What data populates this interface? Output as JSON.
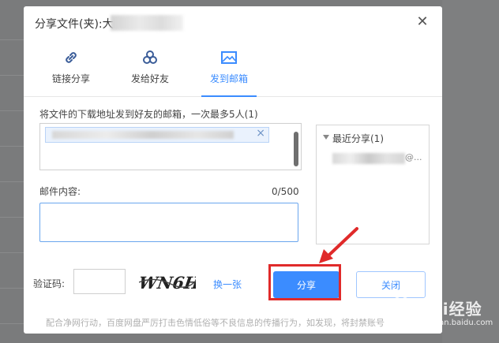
{
  "dialog": {
    "title": "分享文件(夹):大",
    "close_icon": "close-icon"
  },
  "tabs": [
    {
      "label": "链接分享",
      "icon": "link-icon",
      "active": false
    },
    {
      "label": "发给好友",
      "icon": "friends-icon",
      "active": false
    },
    {
      "label": "发到邮箱",
      "icon": "mail-icon",
      "active": true
    }
  ],
  "email": {
    "hint": "将文件的下载地址发到好友的邮箱，一次最多5人(1)",
    "content_label": "邮件内容:",
    "counter": "0/500",
    "content_value": "",
    "chip_remove": "×"
  },
  "recent": {
    "header": "最近分享(1)",
    "item_suffix": "@..."
  },
  "captcha": {
    "label": "验证码:",
    "input_value": "",
    "image_text": "WN6H",
    "refresh_label": "换一张"
  },
  "actions": {
    "share_label": "分享",
    "close_label": "关闭"
  },
  "notice": "配合净网行动，百度网盘严厉打击色情低俗等不良信息的传播行为，如发现，将封禁账号",
  "watermark": {
    "text": "Bai经验",
    "sub": "jingyan.baidu.com"
  },
  "colors": {
    "accent": "#3b8cff",
    "highlight": "#e02a2a"
  }
}
